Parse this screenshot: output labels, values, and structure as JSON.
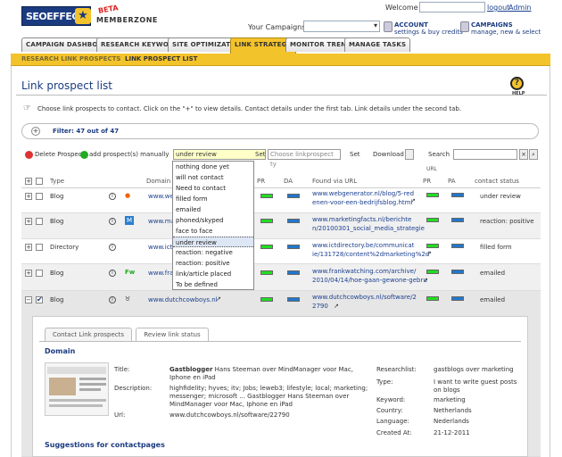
{
  "header": {
    "logo": "SEOEFFECT",
    "beta": "BETA",
    "memberzone": "MEMBERZONE",
    "welcome": "Welcome",
    "logout": "logout",
    "admin": "Admin",
    "your_campaigns": "Your Campaigns:",
    "account_title": "ACCOUNT",
    "account_sub": "settings & buy credits",
    "campaigns_title": "CAMPAIGNS",
    "campaigns_sub": "manage, new & select"
  },
  "tabs": [
    "CAMPAIGN DASHBOARD",
    "RESEARCH KEYWORDS",
    "SITE OPTIMIZATION",
    "LINK STRATEGY",
    "MONITOR TRENDS",
    "MANAGE TASKS"
  ],
  "subnav": [
    "RESEARCH LINK PROSPECTS",
    "LINK PROSPECT LIST"
  ],
  "page": {
    "title": "Link prospect list",
    "help": "HELP",
    "instructions": "Choose link prospects to contact. Click on the \"+\" to view details. Contact details under the first tab. Link details under the second tab.",
    "filter": "Filter: 47 out of 47"
  },
  "toolbar": {
    "delete": "Delete Prospect",
    "add": "add prospect(s) manually",
    "status_value": "under review",
    "set": "Set",
    "lp_placeholder": "Choose linkprospect ty",
    "set2": "Set",
    "download": "Download",
    "search": "Search"
  },
  "dropdown": [
    "nothing done yet",
    "will not contact",
    "Need to contact",
    "filled form",
    "emailed",
    "phoned/skyped",
    "face to face",
    "under review",
    "reaction: negative",
    "reaction: positive",
    "link/article placed",
    "To be defined"
  ],
  "columns": {
    "type": "Type",
    "domain": "Domain",
    "pr": "PR",
    "da": "DA",
    "found": "Found via URL",
    "url_group": "URL",
    "pr2": "PR",
    "pa": "PA",
    "status": "contact status"
  },
  "rows": [
    {
      "type": "Blog",
      "domain": "www.we",
      "url1": "www.webgenerator.nl/blog/5-red",
      "url2": "enen-voor-een-bedrijfsblog.html",
      "status": "under review"
    },
    {
      "type": "Blog",
      "domain": "www.ma",
      "url1": "www.marketingfacts.nl/berichte",
      "url2": "n/20100301_social_media_strategie",
      "status": "reaction: positive"
    },
    {
      "type": "Directory",
      "domain": "www.ict",
      "url1": "www.ictdirectory.be/communicat",
      "url2": "ie/131728/content%2dmarketing%2d",
      "status": "filled form"
    },
    {
      "type": "Blog",
      "domain": "www.fra",
      "url1": "www.frankwatching.com/archive/",
      "url2": "2010/04/14/hoe-gaan-gewone-gebru",
      "status": "emailed"
    },
    {
      "type": "Blog",
      "domain": "www.dutchcowboys.nl",
      "url1": "www.dutchcowboys.nl/software/2",
      "url2": "2790",
      "status": "emailed"
    }
  ],
  "detail": {
    "tab1": "Contact Link prospects",
    "tab2": "Review link status",
    "section": "Domain",
    "title_label": "Title:",
    "title_bold": "Gastblogger",
    "title_rest": " Hans Steeman over MindManager voor Mac, Iphone en iPad",
    "desc_label": "Description:",
    "desc_l1": "highfidelity; hyves; itv; Jobs; leweb3; lifestyle; local; marketing;",
    "desc_l2": "messenger; microsoft ... Gastblogger Hans Steeman over",
    "desc_l3": "MindManager voor Mac, Iphone en iPad",
    "url_label": "Url:",
    "url_value": "www.dutchcowboys.nl/software/22790",
    "researchlist_label": "Researchlist:",
    "researchlist_value": "gastblogs over marketing",
    "type_label": "Type:",
    "type_value": "I want to write guest posts on blogs",
    "keyword_label": "Keyword:",
    "keyword_value": "marketing",
    "country_label": "Country:",
    "country_value": "Netherlands",
    "language_label": "Language:",
    "language_value": "Nederlands",
    "created_label": "Created At:",
    "created_value": "21-12-2011",
    "suggestions": "Suggestions for contactpages"
  }
}
